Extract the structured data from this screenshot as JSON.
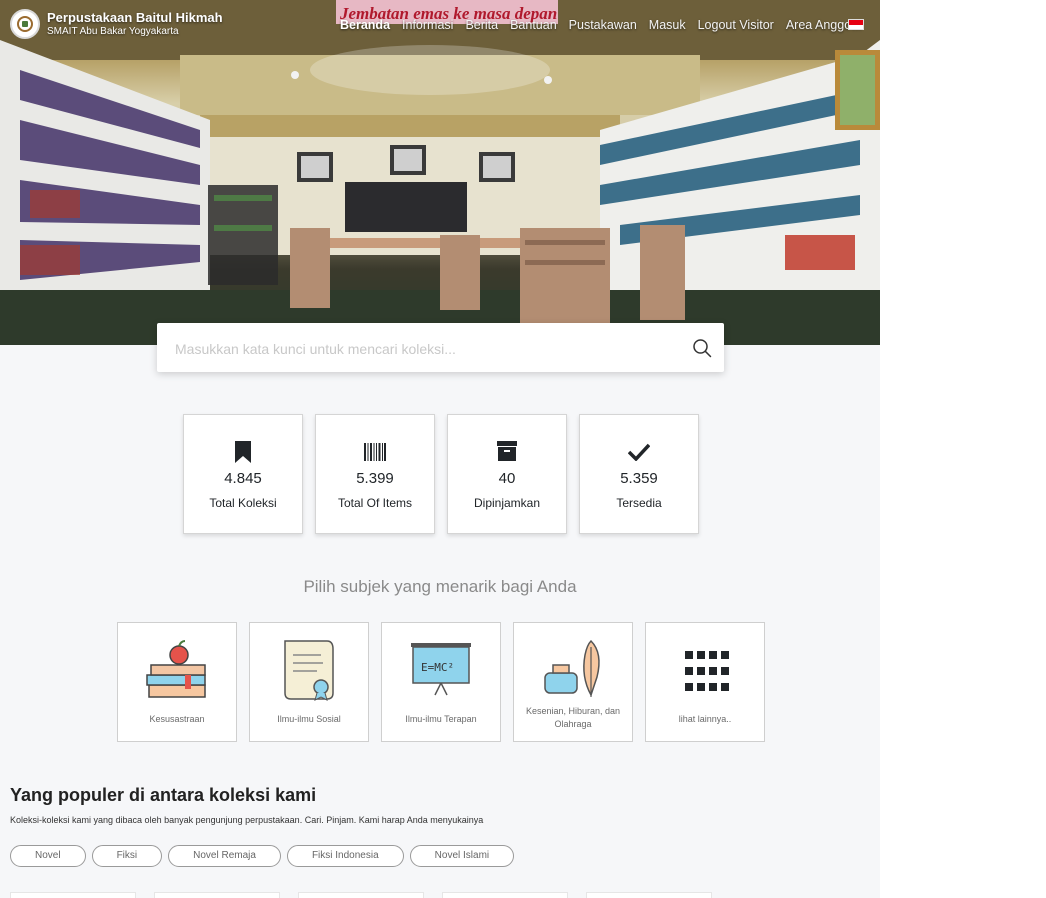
{
  "header": {
    "title": "Perpustakaan Baitul Hikmah",
    "subtitle": "SMAIT Abu Bakar Yogyakarta",
    "nav": [
      "Beranda",
      "Informasi",
      "Berita",
      "Bantuan",
      "Pustakawan",
      "Masuk",
      "Logout Visitor",
      "Area Anggota"
    ],
    "active_nav": "Beranda",
    "banner_text": "Jembatan emas ke masa depan",
    "language_flag": "indonesia-flag-icon"
  },
  "search": {
    "placeholder": "Masukkan kata kunci untuk mencari koleksi...",
    "icon": "search-icon"
  },
  "stats": [
    {
      "icon": "bookmark-icon",
      "value": "4.845",
      "label": "Total Koleksi"
    },
    {
      "icon": "barcode-icon",
      "value": "5.399",
      "label": "Total Of Items"
    },
    {
      "icon": "archive-box-icon",
      "value": "40",
      "label": "Dipinjamkan"
    },
    {
      "icon": "check-icon",
      "value": "5.359",
      "label": "Tersedia"
    }
  ],
  "subjects": {
    "heading": "Pilih subjek yang menarik bagi Anda",
    "items": [
      {
        "icon": "books-apple-icon",
        "label": "Kesusastraan"
      },
      {
        "icon": "certificate-scroll-icon",
        "label": "Ilmu-ilmu Sosial"
      },
      {
        "icon": "blackboard-formula-icon",
        "label": "Ilmu-ilmu Terapan"
      },
      {
        "icon": "quill-ink-icon",
        "label": "Kesenian, Hiburan, dan Olahraga"
      },
      {
        "icon": "grid-dots-icon",
        "label": "lihat lainnya.."
      }
    ]
  },
  "popular": {
    "title": "Yang populer di antara koleksi kami",
    "subtitle": "Koleksi-koleksi kami yang dibaca oleh banyak pengunjung perpustakaan. Cari. Pinjam. Kami harap Anda menyukainya",
    "tags": [
      "Novel",
      "Fiksi",
      "Novel Remaja",
      "Fiksi Indonesia",
      "Novel Islami"
    ]
  },
  "colors": {
    "page_bg": "#f6f7f9",
    "text_dark": "#212529",
    "flag_red": "#e60012"
  }
}
